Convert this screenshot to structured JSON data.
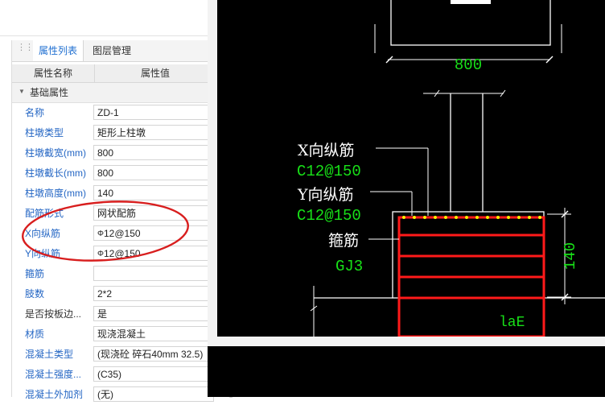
{
  "panel": {
    "tabs": [
      {
        "label": "属性列表",
        "active": true
      },
      {
        "label": "图层管理",
        "active": false
      }
    ],
    "columns": {
      "name": "属性名称",
      "value": "属性值"
    },
    "group": "基础属性",
    "rows": [
      {
        "name": "名称",
        "value": "ZD-1",
        "style": "blue"
      },
      {
        "name": "柱墩类型",
        "value": "矩形上柱墩",
        "style": "blue"
      },
      {
        "name": "柱墩截宽(mm)",
        "value": "800",
        "style": "blue"
      },
      {
        "name": "柱墩截长(mm)",
        "value": "800",
        "style": "blue"
      },
      {
        "name": "柱墩高度(mm)",
        "value": "140",
        "style": "blue"
      },
      {
        "name": "配筋形式",
        "value": "网状配筋",
        "style": "blue"
      },
      {
        "name": "X向纵筋",
        "value": "12@150",
        "rebar_symbol": "Φ",
        "style": "blue"
      },
      {
        "name": "Y向纵筋",
        "value": "12@150",
        "rebar_symbol": "Φ",
        "style": "blue"
      },
      {
        "name": "箍筋",
        "value": "",
        "style": "blue"
      },
      {
        "name": "肢数",
        "value": "2*2",
        "style": "blue"
      },
      {
        "name": "是否按板边...",
        "value": "是",
        "style": "dark"
      },
      {
        "name": "材质",
        "value": "现浇混凝土",
        "style": "blue"
      },
      {
        "name": "混凝土类型",
        "value": "(现浇砼 碎石40mm 32.5)",
        "style": "blue"
      },
      {
        "name": "混凝土强度...",
        "value": "(C35)",
        "style": "blue"
      },
      {
        "name": "混凝土外加剂",
        "value": "(无)",
        "style": "blue"
      }
    ]
  },
  "cad": {
    "dimension_top": "800",
    "dimension_side": "140",
    "labels": {
      "x_rebar": "X向纵筋",
      "x_rebar_spec": "C12@150",
      "y_rebar": "Y向纵筋",
      "y_rebar_spec": "C12@150",
      "stirrup": "箍筋",
      "stirrup_spec": "GJ3",
      "anchorage": "laE"
    },
    "colors": {
      "white": "#ffffff",
      "green": "#18e018",
      "red": "#ff1a1a",
      "yellow": "#ffee00"
    }
  },
  "annotation_color": "#d81e1e"
}
